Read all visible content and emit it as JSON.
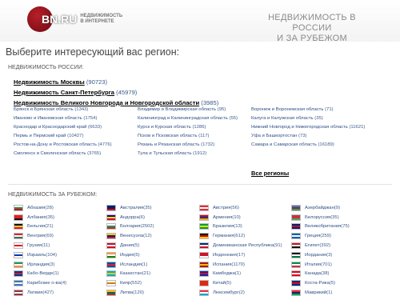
{
  "header": {
    "logo_text": "BN.RU",
    "logo_tagline": "недвижимость в интернете",
    "site_title_line1": "НЕДВИЖИМОСТЬ В РОССИИ",
    "site_title_line2": "И ЗА РУБЕЖОМ"
  },
  "choose_label": "Выберите интересующий вас регион:",
  "russia": {
    "heading": "НЕДВИЖИМОСТЬ РОССИИ:",
    "main_links": [
      {
        "label": "Недвижимость Москвы",
        "count": "(90723)"
      },
      {
        "label": "Недвижимость Санкт-Петербурга",
        "count": "(45979)"
      },
      {
        "label": "Недвижимость Великого Новгорода и Новгородской области",
        "count": "(3985)"
      }
    ],
    "columns": [
      [
        {
          "label": "Брянск и Брянская область",
          "count": "(1343)"
        },
        {
          "label": "Иваново и Ивановская область",
          "count": "(1754)"
        },
        {
          "label": "Краснодар и Краснодарский край",
          "count": "(6633)"
        },
        {
          "label": "Пермь и Пермский край",
          "count": "(10427)"
        },
        {
          "label": "Ростов-на-Дону и Ростовская область",
          "count": "(4776)"
        },
        {
          "label": "Смоленск и Смоленская область",
          "count": "(3765)"
        }
      ],
      [
        {
          "label": "Владимир и Владимирская область",
          "count": "(95)"
        },
        {
          "label": "Калининград и Калининградская область",
          "count": "(55)"
        },
        {
          "label": "Курск и Курская область",
          "count": "(1286)"
        },
        {
          "label": "Псков и Псковская область",
          "count": "(117)"
        },
        {
          "label": "Рязань и Рязанская область",
          "count": "(1732)"
        },
        {
          "label": "Тула и Тульская область",
          "count": "(1912)"
        }
      ],
      [
        {
          "label": "Воронеж и Воронежская область",
          "count": "(71)"
        },
        {
          "label": "Калуга и Калужская область",
          "count": "(35)"
        },
        {
          "label": "Нижний Новгород и Нижегородская область",
          "count": "(11621)"
        },
        {
          "label": "Уфа и Башкортостан",
          "count": "(73)"
        },
        {
          "label": "Самара и Самарская область",
          "count": "(16189)"
        }
      ]
    ],
    "all_regions": "Все регионы"
  },
  "abroad": {
    "heading": "НЕДВИЖИМОСТЬ ЗА РУБЕЖОМ:",
    "columns": [
      [
        {
          "label": "Абхазия",
          "count": "(28)",
          "flag": [
            "#ffffff",
            "#2e8b3a",
            "#c8102e"
          ]
        },
        {
          "label": "Албания",
          "count": "(35)",
          "flag": [
            "#e41e20",
            "#e41e20",
            "#111111"
          ]
        },
        {
          "label": "Бельгия",
          "count": "(21)",
          "flag": [
            "#111111",
            "#f6d21a",
            "#e21b2b"
          ]
        },
        {
          "label": "Венгрия",
          "count": "(69)",
          "flag": [
            "#ce2939",
            "#ffffff",
            "#477050"
          ]
        },
        {
          "label": "Грузия",
          "count": "(11)",
          "flag": [
            "#ffffff",
            "#e8112d",
            "#ffffff"
          ]
        },
        {
          "label": "Израиль",
          "count": "(104)",
          "flag": [
            "#ffffff",
            "#0038b8",
            "#ffffff"
          ]
        },
        {
          "label": "Ирландия",
          "count": "(3)",
          "flag": [
            "#169b62",
            "#ffffff",
            "#ff883e"
          ]
        },
        {
          "label": "Кабо-Верде",
          "count": "(1)",
          "flag": [
            "#003893",
            "#cf2027",
            "#003893"
          ]
        },
        {
          "label": "Карибские о-ва",
          "count": "(4)",
          "flag": [
            "#3a75c4",
            "#ffffff",
            "#3a75c4"
          ]
        },
        {
          "label": "Латвия",
          "count": "(427)",
          "flag": [
            "#9e3039",
            "#ffffff",
            "#9e3039"
          ]
        }
      ],
      [
        {
          "label": "Австралия",
          "count": "(35)",
          "flag": [
            "#012169",
            "#012169",
            "#c8102e"
          ]
        },
        {
          "label": "Андорра",
          "count": "(6)",
          "flag": [
            "#10069f",
            "#fedd00",
            "#d50032"
          ]
        },
        {
          "label": "Болгария",
          "count": "(2502)",
          "flag": [
            "#ffffff",
            "#00966e",
            "#d62612"
          ]
        },
        {
          "label": "Венесуэла",
          "count": "(12)",
          "flag": [
            "#ffcc00",
            "#00247d",
            "#cf142b"
          ]
        },
        {
          "label": "Дания",
          "count": "(5)",
          "flag": [
            "#c8102e",
            "#ffffff",
            "#c8102e"
          ]
        },
        {
          "label": "Индия",
          "count": "(5)",
          "flag": [
            "#ff9933",
            "#ffffff",
            "#138808"
          ]
        },
        {
          "label": "Исландия",
          "count": "(1)",
          "flag": [
            "#02529c",
            "#dc1e35",
            "#02529c"
          ]
        },
        {
          "label": "Казахстан",
          "count": "(21)",
          "flag": [
            "#00afca",
            "#fec50c",
            "#00afca"
          ]
        },
        {
          "label": "Кипр",
          "count": "(552)",
          "flag": [
            "#ffffff",
            "#d57800",
            "#ffffff"
          ]
        },
        {
          "label": "Литва",
          "count": "(120)",
          "flag": [
            "#fdb913",
            "#006a44",
            "#c1272d"
          ]
        }
      ],
      [
        {
          "label": "Австрия",
          "count": "(56)",
          "flag": [
            "#ed2939",
            "#ffffff",
            "#ed2939"
          ]
        },
        {
          "label": "Армения",
          "count": "(10)",
          "flag": [
            "#d90012",
            "#0033a0",
            "#f2a800"
          ]
        },
        {
          "label": "Бразилия",
          "count": "(13)",
          "flag": [
            "#009c3b",
            "#ffdf00",
            "#009c3b"
          ]
        },
        {
          "label": "Германия",
          "count": "(612)",
          "flag": [
            "#111111",
            "#dd0000",
            "#ffce00"
          ]
        },
        {
          "label": "Доминиканская Республика",
          "count": "(91)",
          "flag": [
            "#002d62",
            "#ffffff",
            "#ce1126"
          ]
        },
        {
          "label": "Индонезия",
          "count": "(17)",
          "flag": [
            "#ce1126",
            "#ce1126",
            "#ffffff"
          ]
        },
        {
          "label": "Испания",
          "count": "(1170)",
          "flag": [
            "#aa151b",
            "#f1bf00",
            "#aa151b"
          ]
        },
        {
          "label": "Камбоджа",
          "count": "(1)",
          "flag": [
            "#032ea1",
            "#e00025",
            "#032ea1"
          ]
        },
        {
          "label": "Китай",
          "count": "(5)",
          "flag": [
            "#de2910",
            "#de2910",
            "#de2910"
          ]
        },
        {
          "label": "Люксембург",
          "count": "(2)",
          "flag": [
            "#ef3340",
            "#ffffff",
            "#00a3e0"
          ]
        }
      ],
      [
        {
          "label": "Азербайджан",
          "count": "(9)",
          "flag": [
            "#0092bc",
            "#e4002b",
            "#00af66"
          ]
        },
        {
          "label": "Белоруссия",
          "count": "(35)",
          "flag": [
            "#c8313e",
            "#c8313e",
            "#4aa657"
          ]
        },
        {
          "label": "Великобритания",
          "count": "(75)",
          "flag": [
            "#012169",
            "#c8102e",
            "#012169"
          ]
        },
        {
          "label": "Греция",
          "count": "(259)",
          "flag": [
            "#0d5eaf",
            "#ffffff",
            "#0d5eaf"
          ]
        },
        {
          "label": "Египет",
          "count": "(392)",
          "flag": [
            "#ce1126",
            "#ffffff",
            "#111111"
          ]
        },
        {
          "label": "Иордания",
          "count": "(3)",
          "flag": [
            "#111111",
            "#ffffff",
            "#007a3d"
          ]
        },
        {
          "label": "Италия",
          "count": "(701)",
          "flag": [
            "#009246",
            "#ffffff",
            "#ce2b37"
          ]
        },
        {
          "label": "Канада",
          "count": "(38)",
          "flag": [
            "#d80621",
            "#ffffff",
            "#d80621"
          ]
        },
        {
          "label": "Коста-Рика",
          "count": "(5)",
          "flag": [
            "#002b7f",
            "#ce1126",
            "#002b7f"
          ]
        },
        {
          "label": "Маврикий",
          "count": "(1)",
          "flag": [
            "#ea2839",
            "#1a206d",
            "#00a551"
          ]
        }
      ]
    ]
  }
}
